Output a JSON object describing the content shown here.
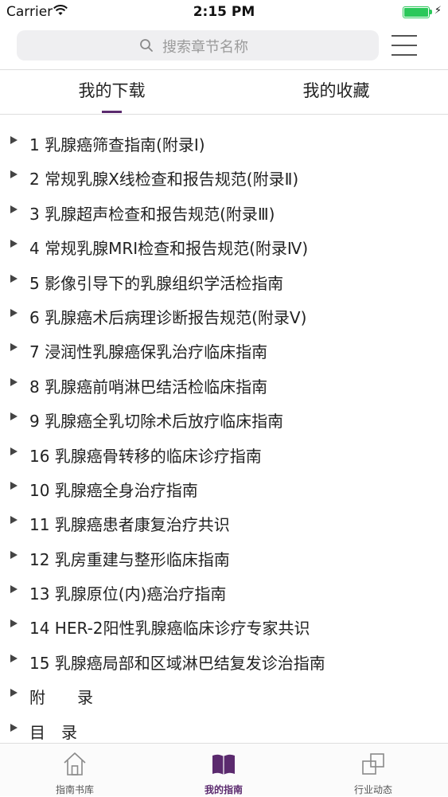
{
  "status_bar": {
    "carrier": "Carrier",
    "time": "2:15 PM",
    "battery_level": 1.0,
    "battery_color": "#2bc85a"
  },
  "search": {
    "placeholder": "搜索章节名称",
    "icon": "search-icon"
  },
  "header": {
    "menu_icon": "hamburger-menu-icon"
  },
  "tabs": [
    {
      "label": "我的下载",
      "selected": true
    },
    {
      "label": "我的收藏",
      "selected": false
    }
  ],
  "list": {
    "items": [
      "1 乳腺癌筛查指南(附录Ⅰ)",
      "2 常规乳腺X线检查和报告规范(附录Ⅱ)",
      "3 乳腺超声检查和报告规范(附录Ⅲ)",
      "4 常规乳腺MRI检查和报告规范(附录Ⅳ)",
      "5 影像引导下的乳腺组织学活检指南",
      "6 乳腺癌术后病理诊断报告规范(附录Ⅴ)",
      "7 浸润性乳腺癌保乳治疗临床指南",
      "8 乳腺癌前哨淋巴结活检临床指南",
      "9 乳腺癌全乳切除术后放疗临床指南",
      "16 乳腺癌骨转移的临床诊疗指南",
      "10 乳腺癌全身治疗指南",
      "11 乳腺癌患者康复治疗共识",
      "12 乳房重建与整形临床指南",
      "13 乳腺原位(内)癌治疗指南",
      "14 HER-2阳性乳腺癌临床诊疗专家共识",
      "15 乳腺癌局部和区域淋巴结复发诊治指南",
      "附　　录",
      "目　录"
    ]
  },
  "tab_bar": [
    {
      "label": "指南书库",
      "icon": "home-icon",
      "active": false
    },
    {
      "label": "我的指南",
      "icon": "book-icon",
      "active": true
    },
    {
      "label": "行业动态",
      "icon": "news-squares-icon",
      "active": false
    }
  ],
  "colors": {
    "accent": "#5b2a6e",
    "text": "#222222",
    "divider": "#dedede",
    "search_bg": "#efeff1"
  }
}
